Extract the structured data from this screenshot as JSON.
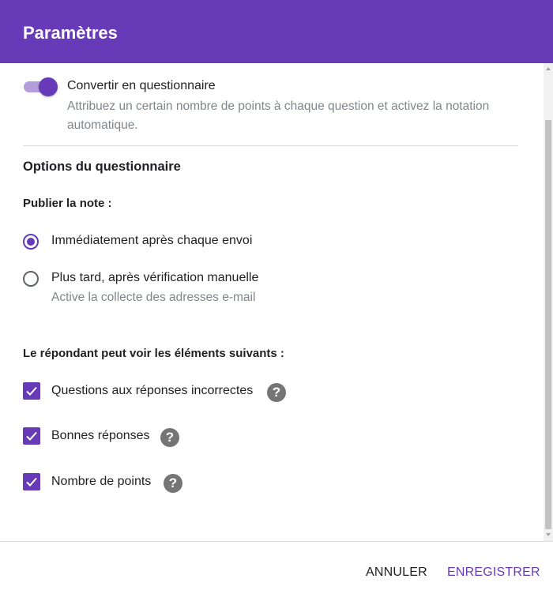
{
  "dialog": {
    "title": "Paramètres"
  },
  "quiz_toggle": {
    "label": "Convertir en questionnaire",
    "description": "Attribuez un certain nombre de points à chaque question et activez la notation automatique.",
    "enabled": true
  },
  "quiz_options": {
    "title": "Options du questionnaire",
    "publish_grade": {
      "title": "Publier la note :",
      "options": [
        {
          "label": "Immédiatement après chaque envoi",
          "selected": true
        },
        {
          "label": "Plus tard, après vérification manuelle",
          "sub": "Active la collecte des adresses e-mail",
          "selected": false
        }
      ]
    },
    "respondent_can_see": {
      "title": "Le répondant peut voir les éléments suivants :",
      "items": [
        {
          "label": "Questions aux réponses incorrectes",
          "checked": true
        },
        {
          "label": "Bonnes réponses",
          "checked": true
        },
        {
          "label": "Nombre de points",
          "checked": true
        }
      ]
    }
  },
  "footer": {
    "cancel_label": "ANNULER",
    "save_label": "ENREGISTRER"
  },
  "colors": {
    "accent": "#673ab7",
    "accent_light": "#b39ddb",
    "help_icon": "#757575",
    "secondary_text": "#80868b"
  }
}
